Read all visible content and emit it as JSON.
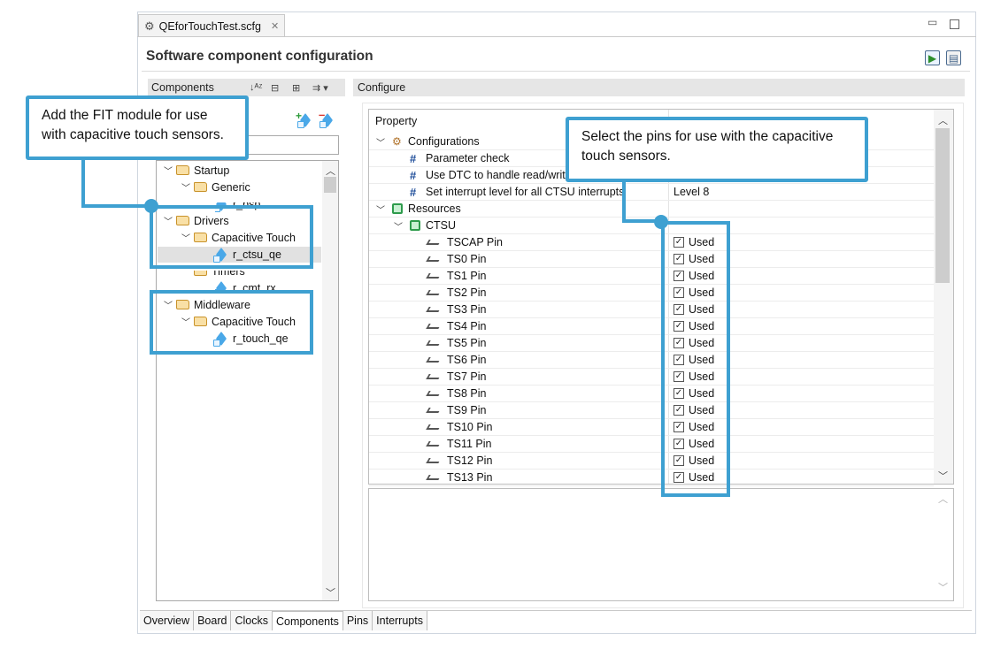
{
  "window": {
    "tab_title": "QEforTouchTest.scfg",
    "editor_title": "Software component configuration"
  },
  "components_panel": {
    "header": "Components",
    "tree": [
      {
        "label": "Startup",
        "type": "folder",
        "expanded": true
      },
      {
        "label": "Generic",
        "type": "folder",
        "expanded": true
      },
      {
        "label": "r_bsp",
        "type": "component"
      },
      {
        "label": "Drivers",
        "type": "folder",
        "expanded": true
      },
      {
        "label": "Capacitive Touch",
        "type": "folder",
        "expanded": true
      },
      {
        "label": "r_ctsu_qe",
        "type": "component",
        "selected": true
      },
      {
        "label": "Timers",
        "type": "folder",
        "expanded": true
      },
      {
        "label": "r_cmt_rx",
        "type": "component"
      },
      {
        "label": "Middleware",
        "type": "folder",
        "expanded": true
      },
      {
        "label": "Capacitive Touch",
        "type": "folder",
        "expanded": true
      },
      {
        "label": "r_touch_qe",
        "type": "component"
      }
    ]
  },
  "configure_panel": {
    "header": "Configure",
    "column_property": "Property",
    "rows": [
      {
        "name": "Configurations",
        "kind": "group",
        "value": ""
      },
      {
        "name": "Parameter check",
        "kind": "param",
        "value": ""
      },
      {
        "name": "Use DTC to handle read/writ",
        "kind": "param",
        "value": ""
      },
      {
        "name": "Set interrupt level for all CTSU interrupts",
        "kind": "param",
        "value": "Level 8"
      },
      {
        "name": "Resources",
        "kind": "group",
        "value": ""
      },
      {
        "name": "CTSU",
        "kind": "subgroup",
        "value": ""
      },
      {
        "name": "TSCAP Pin",
        "kind": "pin",
        "value": "Used"
      },
      {
        "name": "TS0 Pin",
        "kind": "pin",
        "value": "Used"
      },
      {
        "name": "TS1 Pin",
        "kind": "pin",
        "value": "Used"
      },
      {
        "name": "TS2 Pin",
        "kind": "pin",
        "value": "Used"
      },
      {
        "name": "TS3 Pin",
        "kind": "pin",
        "value": "Used"
      },
      {
        "name": "TS4 Pin",
        "kind": "pin",
        "value": "Used"
      },
      {
        "name": "TS5 Pin",
        "kind": "pin",
        "value": "Used"
      },
      {
        "name": "TS6 Pin",
        "kind": "pin",
        "value": "Used"
      },
      {
        "name": "TS7 Pin",
        "kind": "pin",
        "value": "Used"
      },
      {
        "name": "TS8 Pin",
        "kind": "pin",
        "value": "Used"
      },
      {
        "name": "TS9 Pin",
        "kind": "pin",
        "value": "Used"
      },
      {
        "name": "TS10 Pin",
        "kind": "pin",
        "value": "Used"
      },
      {
        "name": "TS11 Pin",
        "kind": "pin",
        "value": "Used"
      },
      {
        "name": "TS12 Pin",
        "kind": "pin",
        "value": "Used"
      },
      {
        "name": "TS13 Pin",
        "kind": "pin",
        "value": "Used"
      }
    ]
  },
  "bottom_tabs": [
    "Overview",
    "Board",
    "Clocks",
    "Components",
    "Pins",
    "Interrupts"
  ],
  "active_bottom_tab": "Components",
  "callouts": {
    "fit_module": "Add the FIT module for use with capacitive touch sensors.",
    "pins": "Select the pins for use with the capacitive touch sensors."
  },
  "colors": {
    "callout": "#3ea0d1",
    "selection": "#e1e1e1",
    "folder": "#f9e0a6",
    "component": "#4aa8e8"
  }
}
